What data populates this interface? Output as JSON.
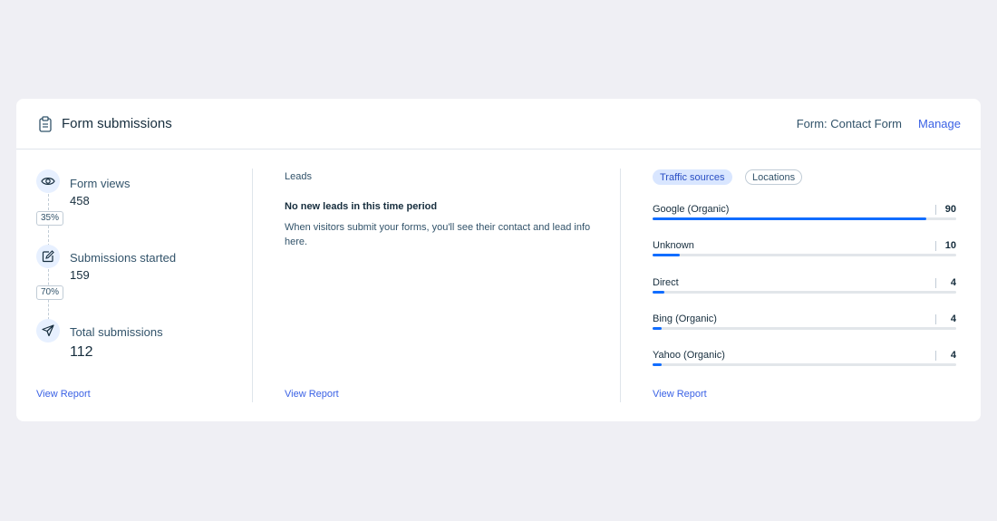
{
  "header": {
    "title": "Form submissions",
    "form_label": "Form: Contact Form",
    "manage_label": "Manage"
  },
  "funnel": {
    "steps": [
      {
        "label": "Form views",
        "value": "458",
        "icon": "eye-icon"
      },
      {
        "label": "Submissions started",
        "value": "159",
        "icon": "edit-icon"
      },
      {
        "label": "Total submissions",
        "value": "112",
        "icon": "send-icon"
      }
    ],
    "conversions": [
      "35%",
      "70%"
    ],
    "view_report": "View Report"
  },
  "leads": {
    "title": "Leads",
    "empty_title": "No new leads in this time period",
    "empty_desc": "When visitors submit your forms, you'll see their contact and lead info here.",
    "view_report": "View Report"
  },
  "traffic": {
    "tabs": [
      {
        "label": "Traffic sources",
        "active": true
      },
      {
        "label": "Locations",
        "active": false
      }
    ],
    "sources": [
      {
        "name": "Google (Organic)",
        "count": "90",
        "share": 0.9
      },
      {
        "name": "Unknown",
        "count": "10",
        "share": 0.09
      },
      {
        "name": "Direct",
        "count": "4",
        "share": 0.04
      },
      {
        "name": "Bing (Organic)",
        "count": "4",
        "share": 0.03
      },
      {
        "name": "Yahoo (Organic)",
        "count": "4",
        "share": 0.03
      }
    ],
    "view_report": "View Report"
  },
  "colors": {
    "accent": "#3b62e5",
    "bar": "#116dff",
    "background": "#efeff4"
  }
}
